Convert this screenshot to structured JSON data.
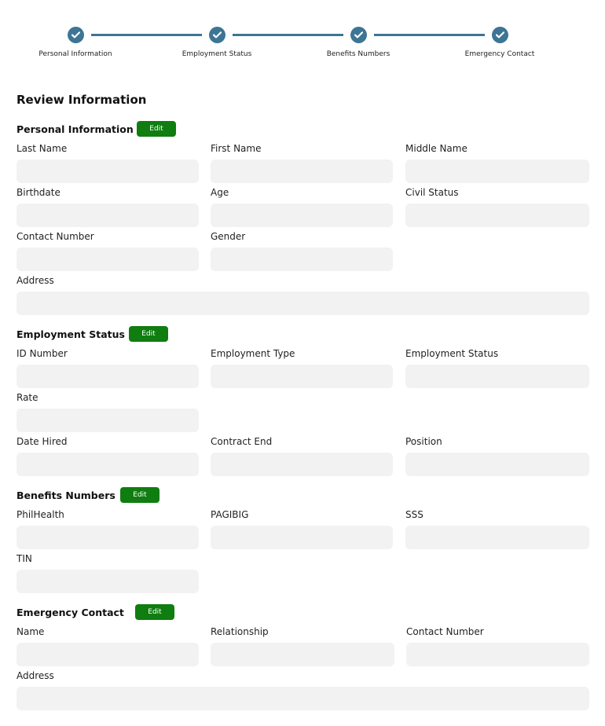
{
  "stepper": {
    "steps": [
      {
        "label": "Personal Information"
      },
      {
        "label": "Employment Status"
      },
      {
        "label": "Benefits Numbers"
      },
      {
        "label": "Emergency Contact"
      }
    ]
  },
  "page_title": "Review Information",
  "edit_label": "Edit",
  "personal": {
    "title": "Personal Information",
    "last_name": {
      "label": "Last Name",
      "value": ""
    },
    "first_name": {
      "label": "First Name",
      "value": ""
    },
    "middle_name": {
      "label": "Middle Name",
      "value": ""
    },
    "birthdate": {
      "label": "Birthdate",
      "value": ""
    },
    "age": {
      "label": "Age",
      "value": ""
    },
    "civil_status": {
      "label": "Civil Status",
      "value": ""
    },
    "contact_number": {
      "label": "Contact Number",
      "value": ""
    },
    "gender": {
      "label": "Gender",
      "value": ""
    },
    "address": {
      "label": "Address",
      "value": ""
    }
  },
  "employment": {
    "title": "Employment Status",
    "id_number": {
      "label": "ID Number",
      "value": ""
    },
    "employment_type": {
      "label": "Employment Type",
      "value": ""
    },
    "employment_status": {
      "label": "Employment Status",
      "value": ""
    },
    "rate": {
      "label": "Rate",
      "value": ""
    },
    "date_hired": {
      "label": "Date Hired",
      "value": ""
    },
    "contract_end": {
      "label": "Contract End",
      "value": ""
    },
    "position": {
      "label": "Position",
      "value": ""
    }
  },
  "benefits": {
    "title": "Benefits Numbers",
    "philhealth": {
      "label": "PhilHealth",
      "value": ""
    },
    "pagibig": {
      "label": "PAGIBIG",
      "value": ""
    },
    "sss": {
      "label": "SSS",
      "value": ""
    },
    "tin": {
      "label": "TIN",
      "value": ""
    }
  },
  "emergency": {
    "title": "Emergency Contact",
    "name": {
      "label": "Name",
      "value": ""
    },
    "relationship": {
      "label": "Relationship",
      "value": ""
    },
    "contact_number": {
      "label": "Contact Number",
      "value": ""
    },
    "address": {
      "label": "Address",
      "value": ""
    }
  },
  "colors": {
    "step_accent": "#3d7595",
    "edit_button": "#0f7d0f",
    "field_background": "#f2f2f2"
  },
  "icons": {
    "step_complete": "check-icon"
  }
}
